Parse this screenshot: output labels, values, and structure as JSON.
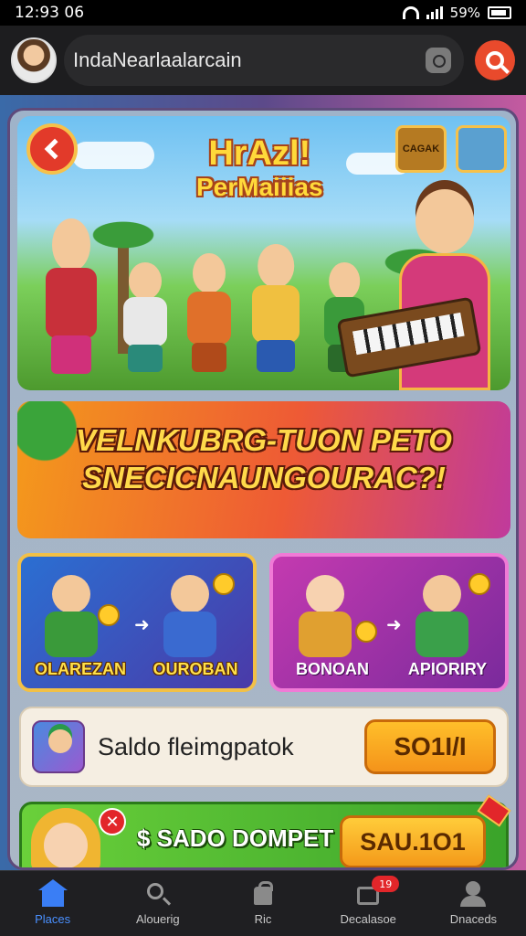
{
  "status_bar": {
    "time": "12:93 06",
    "battery": "59%"
  },
  "header": {
    "search_text": "IndaNearlaalarcain"
  },
  "hero": {
    "title_line1": "HrAzl!",
    "title_line2": "PerMaiiias",
    "badge_left": "CAGAK"
  },
  "promo": {
    "line1": "VELNKUBRG-TUON PETO",
    "line2": "SNECICNAUNGOURAC?!"
  },
  "features": [
    {
      "left_label": "OLAREZAN",
      "right_label": "OUROBAN"
    },
    {
      "left_label": "BONOAN",
      "right_label": "APIORIRY"
    }
  ],
  "saldo": {
    "label": "Saldo fleimgpatok",
    "button_label": "SO1I/I"
  },
  "wallet": {
    "label": "$ SADO DOMPET",
    "button_label": "SAU.1O1",
    "close_symbol": "✕"
  },
  "bottom_nav": [
    {
      "label": "Places",
      "icon": "home-icon"
    },
    {
      "label": "Alouerig",
      "icon": "search-icon"
    },
    {
      "label": "Ric",
      "icon": "bag-icon"
    },
    {
      "label": "Decalasoe",
      "icon": "box-icon",
      "badge": "19"
    },
    {
      "label": "Dnaceds",
      "icon": "person-icon"
    }
  ]
}
